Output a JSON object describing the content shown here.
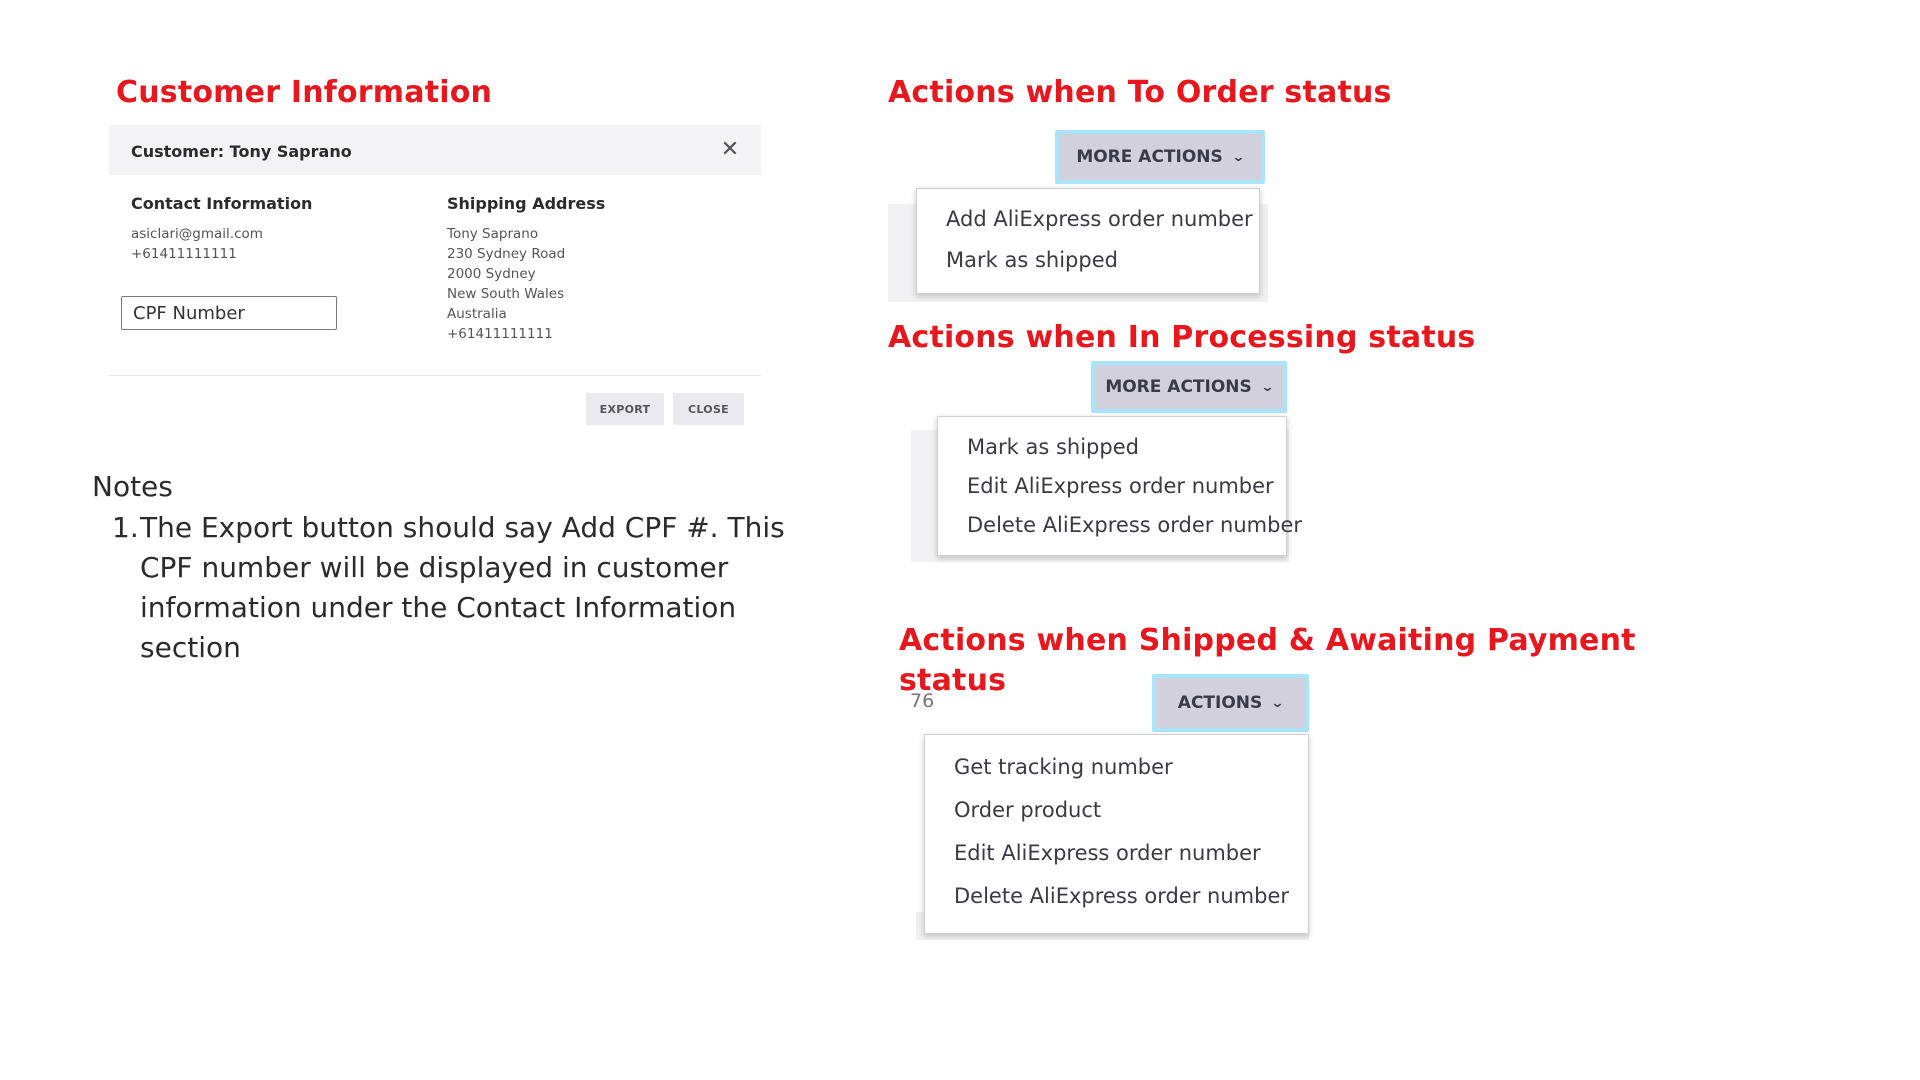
{
  "headings": {
    "customer_info": "Customer Information",
    "to_order": "Actions when To Order status",
    "in_processing": "Actions when In Processing status",
    "shipped_line1": "Actions when Shipped & Awaiting Payment",
    "shipped_line2": "status"
  },
  "modal": {
    "title": "Customer: Tony Saprano",
    "close_icon": "close-x-icon",
    "contact": {
      "title": "Contact Information",
      "email": "asiclari@gmail.com",
      "phone": "+61411111111"
    },
    "cpf_placeholder": "CPF Number",
    "shipping": {
      "title": "Shipping Address",
      "lines": [
        "Tony Saprano",
        "230 Sydney Road",
        "2000 Sydney",
        "New South Wales",
        "Australia",
        "+61411111111"
      ]
    },
    "export_label": "EXPORT",
    "close_label": "CLOSE"
  },
  "notes": {
    "title": "Notes",
    "number": "1.",
    "text": "The Export button should say Add CPF #. This CPF number will be displayed in customer information under the Contact Information section"
  },
  "to_order": {
    "button_label": "MORE ACTIONS",
    "items": [
      "Add AliExpress order number",
      "Mark as shipped"
    ]
  },
  "in_processing": {
    "button_label": "MORE ACTIONS",
    "items": [
      "Mark as shipped",
      "Edit AliExpress order number",
      "Delete AliExpress order number"
    ]
  },
  "shipped": {
    "button_label": "ACTIONS",
    "fragment": "76",
    "items": [
      "Get tracking number",
      "Order product",
      "Edit AliExpress order number",
      "Delete AliExpress order number"
    ]
  },
  "colors": {
    "heading_red": "#e8171d",
    "button_bg": "#d2d0dc",
    "button_outline": "#a9e4fb"
  }
}
